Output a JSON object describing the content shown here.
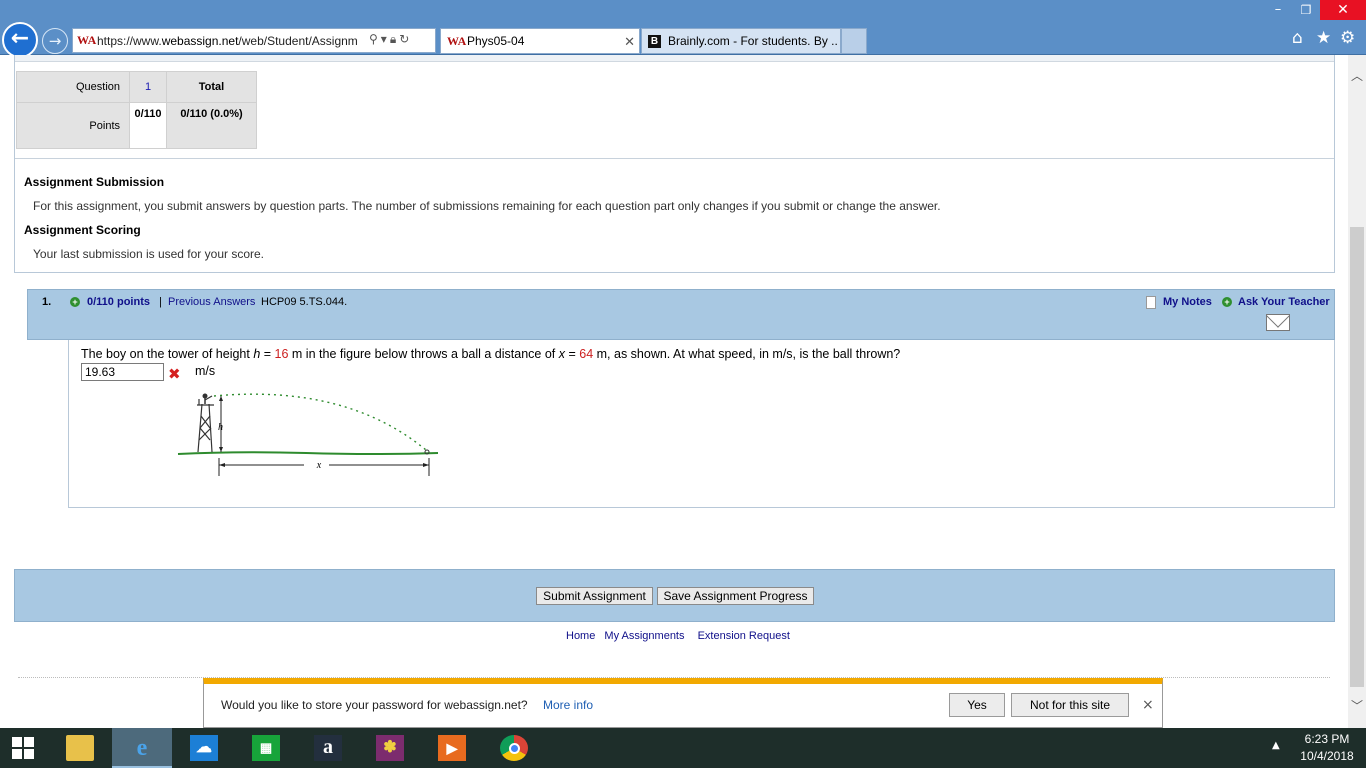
{
  "browser": {
    "url": "https://www.webassign.net/web/Student/Assignm",
    "url_prefix": "https://www.",
    "url_domain": "webassign.net",
    "url_path": "/web/Student/Assignm",
    "favicon_text": "WA",
    "tabs": [
      {
        "title": "Phys05-04",
        "active": true
      },
      {
        "title": "Brainly.com - For students. By ...",
        "active": false
      }
    ],
    "window_controls": {
      "minimize": "–",
      "maximize": "❐",
      "close": "✕"
    },
    "icons": {
      "home": "home-icon",
      "favorites": "star-icon",
      "settings": "gear-icon"
    }
  },
  "score_table": {
    "question_label": "Question",
    "points_label": "Points",
    "question_number": "1",
    "total_label": "Total",
    "question_points": "0/110",
    "total_points": "0/110 (0.0%)"
  },
  "assignment_info": {
    "submission_title": "Assignment Submission",
    "submission_text": "For this assignment, you submit answers by question parts. The number of submissions remaining for each question part only changes if you submit or change the answer.",
    "scoring_title": "Assignment Scoring",
    "scoring_text": "Your last submission is used for your score."
  },
  "question": {
    "number": "1.",
    "points": "0/110 points",
    "separator": "|",
    "previous_answers": "Previous Answers",
    "code": "HCP09 5.TS.044.",
    "my_notes": "My Notes",
    "ask_teacher": "Ask Your Teacher",
    "text_part1": "The boy on the tower of height ",
    "var_h": "h",
    "eq": " = ",
    "h_value": "16",
    "text_part2": " m in the figure below throws a ball a distance of ",
    "var_x": "x",
    "eq2": " = ",
    "x_value": "64",
    "text_part3": " m, as shown. At what speed, in m/s, is the ball thrown?",
    "answer_value": "19.63",
    "answer_status": "incorrect",
    "unit": "m/s",
    "figure_label_h": "h",
    "figure_label_x": "x"
  },
  "actions": {
    "submit": "Submit Assignment",
    "save": "Save Assignment Progress"
  },
  "footer_links": [
    "Home",
    "My Assignments",
    "Extension Request"
  ],
  "notification": {
    "text": "Would you like to store your password for webassign.net?",
    "more_info": "More info",
    "yes": "Yes",
    "not_for_site": "Not for this site",
    "close": "×"
  },
  "taskbar": {
    "apps": [
      "start",
      "file-explorer",
      "internet-explorer",
      "onedrive",
      "store",
      "amazon",
      "photos-app",
      "media-player",
      "chrome"
    ],
    "time": "6:23 PM",
    "date": "10/4/2018"
  },
  "colors": {
    "chrome_blue": "#5b8fc7",
    "panel_blue": "#a8c8e2",
    "link_navy": "#10108a",
    "value_red": "#cc2020",
    "notify_orange": "#f2a900"
  }
}
